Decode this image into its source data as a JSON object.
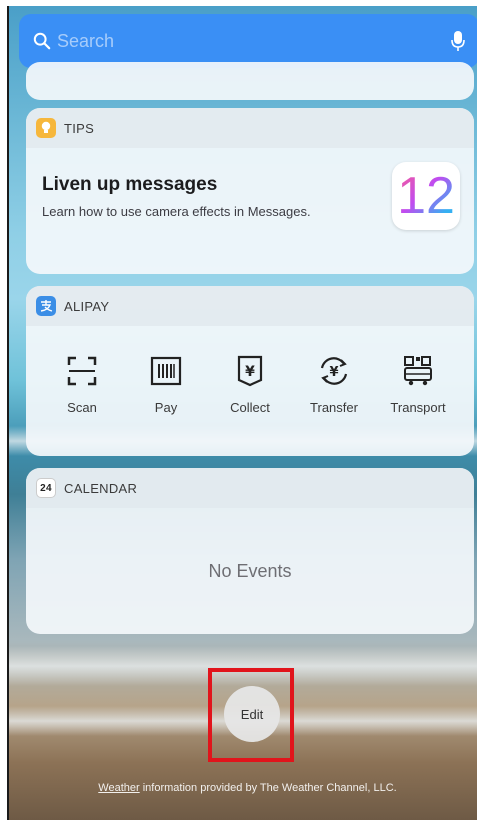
{
  "search": {
    "placeholder": "Search"
  },
  "tips": {
    "app_name": "TIPS",
    "title": "Liven up messages",
    "subtitle": "Learn how to use camera effects in Messages.",
    "badge": "12"
  },
  "alipay": {
    "app_name": "ALIPAY",
    "actions": [
      {
        "label": "Scan",
        "icon": "scan-icon"
      },
      {
        "label": "Pay",
        "icon": "barcode-icon"
      },
      {
        "label": "Collect",
        "icon": "yuan-receipt-icon"
      },
      {
        "label": "Transfer",
        "icon": "yuan-transfer-icon"
      },
      {
        "label": "Transport",
        "icon": "qr-bus-icon"
      }
    ]
  },
  "calendar": {
    "app_name": "CALENDAR",
    "icon_day": "24",
    "empty_text": "No Events"
  },
  "edit": {
    "label": "Edit"
  },
  "attribution": {
    "link_text": "Weather",
    "text": " information provided by The Weather Channel, LLC."
  }
}
